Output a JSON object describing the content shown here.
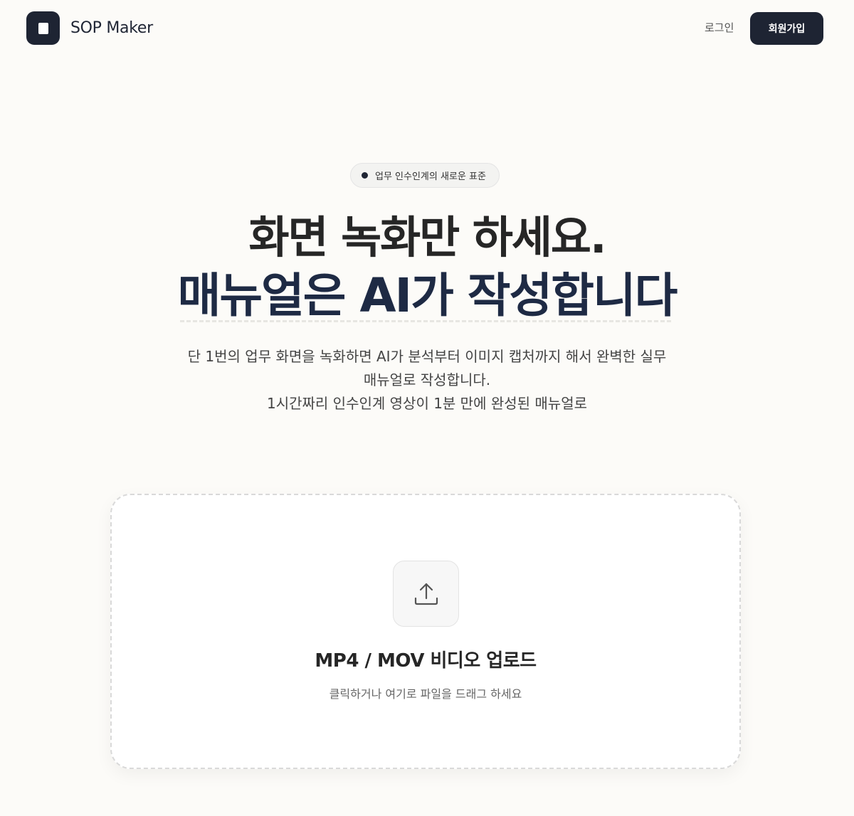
{
  "header": {
    "logo_text": "SOP Maker",
    "login_label": "로그인",
    "signup_label": "회원가입"
  },
  "hero": {
    "badge_text": "업무 인수인계의 새로운 표준",
    "headline_line1": "화면 녹화만 하세요.",
    "headline_line2": "매뉴얼은 AI가 작성합니다",
    "sub_line1": "단 1번의 업무 화면을 녹화하면 AI가 분석부터 이미지 캡처까지 해서 완벽한 실무",
    "sub_line2": "매뉴얼로 작성합니다.",
    "sub_line3": "1시간짜리 인수인계 영상이 1분 만에 완성된 매뉴얼로"
  },
  "upload": {
    "title": "MP4 / MOV 비디오 업로드",
    "subtitle": "클릭하거나 여기로 파일을 드래그 하세요",
    "icon": "upload-icon"
  },
  "colors": {
    "background": "#fcfbf8",
    "primary": "#1e2433",
    "headline_accent": "#1e2a44"
  }
}
